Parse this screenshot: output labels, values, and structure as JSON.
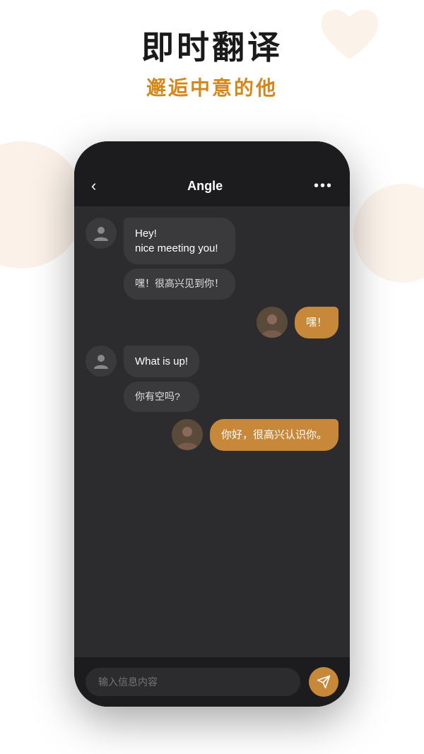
{
  "header": {
    "main_title": "即时翻译",
    "sub_title": "邂逅中意的他"
  },
  "chat": {
    "contact_name": "Angle",
    "back_icon": "‹",
    "more_icon": "•••",
    "messages": [
      {
        "id": "msg1",
        "side": "left",
        "text": "Hey!\nnice meeting you!",
        "translation": "嘿！很高兴见到你！",
        "has_avatar": true
      },
      {
        "id": "msg2",
        "side": "right",
        "text": "嘿！",
        "has_avatar": true
      },
      {
        "id": "msg3",
        "side": "left",
        "text": "What is up!",
        "translation": "你有空吗?",
        "has_avatar": true
      },
      {
        "id": "msg4",
        "side": "right",
        "text": "你好，很高兴认识你。",
        "has_avatar": true
      }
    ],
    "input_placeholder": "输入信息内容"
  }
}
